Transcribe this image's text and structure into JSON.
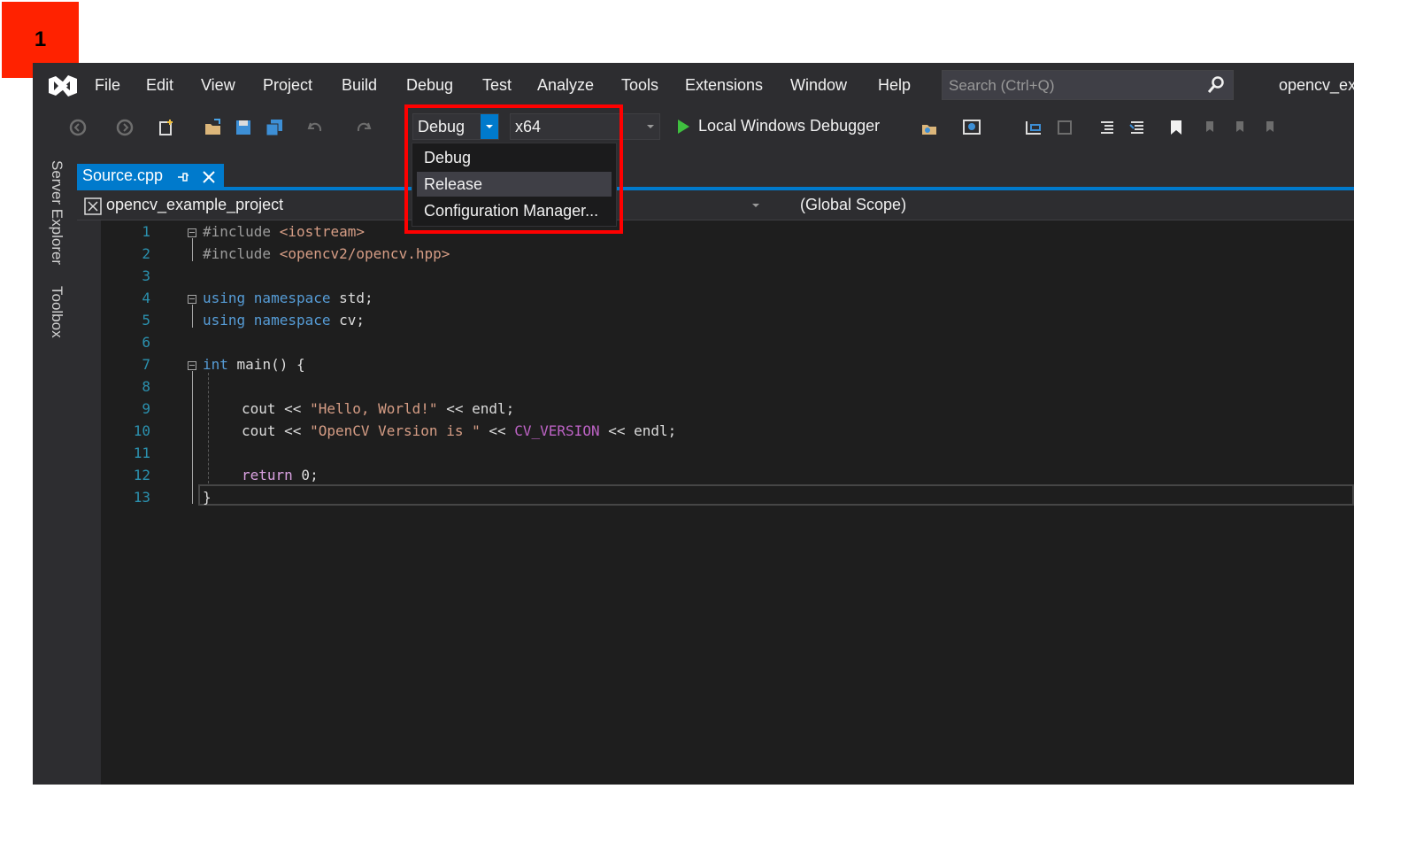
{
  "step_badge": "1",
  "menu": {
    "items": [
      "File",
      "Edit",
      "View",
      "Project",
      "Build",
      "Debug",
      "Test",
      "Analyze",
      "Tools",
      "Extensions",
      "Window",
      "Help"
    ],
    "search_placeholder": "Search (Ctrl+Q)",
    "project_name": "opencv_ex"
  },
  "toolbar": {
    "configuration": "Debug",
    "platform": "x64",
    "debugger": "Local Windows Debugger"
  },
  "config_dropdown": {
    "options": [
      "Debug",
      "Release",
      "Configuration Manager..."
    ],
    "highlighted": "Release"
  },
  "side_panel": {
    "tabs": [
      "Server Explorer",
      "Toolbox"
    ]
  },
  "document_tab": {
    "filename": "Source.cpp"
  },
  "nav_bar": {
    "project": "opencv_example_project",
    "scope": "(Global Scope)"
  },
  "code": {
    "line_numbers": [
      "1",
      "2",
      "3",
      "4",
      "5",
      "6",
      "7",
      "8",
      "9",
      "10",
      "11",
      "12",
      "13"
    ],
    "lines": {
      "l1_pp": "#include ",
      "l1_arg": "<iostream>",
      "l2_pp": "#include ",
      "l2_arg": "<opencv2/opencv.hpp>",
      "l4_kw": "using namespace",
      "l4_id": " std;",
      "l5_kw": "using namespace",
      "l5_id": " cv;",
      "l7_kw": "int",
      "l7_id": " main() {",
      "l9_a": "cout << ",
      "l9_str": "\"Hello, World!\"",
      "l9_b": " << endl;",
      "l10_a": "cout << ",
      "l10_str": "\"OpenCV Version is \"",
      "l10_b": " << ",
      "l10_mac": "CV_VERSION",
      "l10_c": " << endl;",
      "l12_kw": "return",
      "l12_id": " 0;",
      "l13": "}"
    }
  },
  "colors": {
    "accent": "#007acc",
    "highlight_border": "#ff0000",
    "badge": "#ff2200"
  }
}
